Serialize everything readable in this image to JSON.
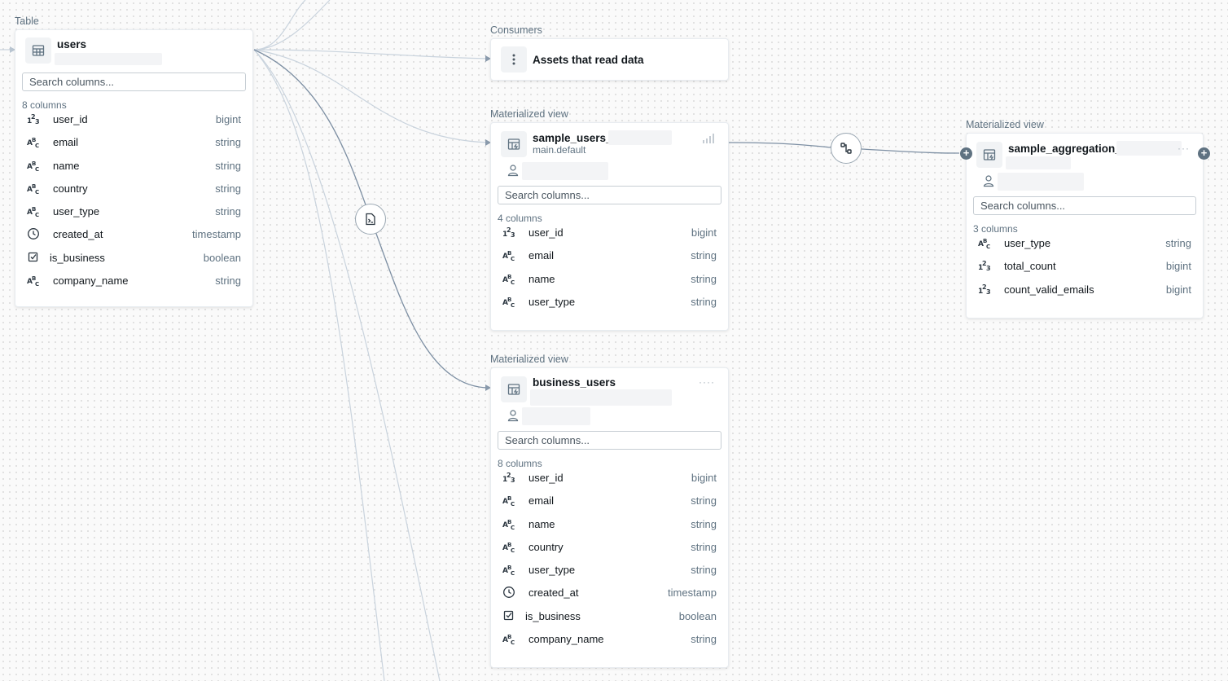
{
  "users_node": {
    "label": "Table",
    "title": "users",
    "search_placeholder": "Search columns...",
    "col_count": "8 columns",
    "columns": [
      {
        "name": "user_id",
        "type": "bigint",
        "icon": "number-icon"
      },
      {
        "name": "email",
        "type": "string",
        "icon": "string-icon"
      },
      {
        "name": "name",
        "type": "string",
        "icon": "string-icon"
      },
      {
        "name": "country",
        "type": "string",
        "icon": "string-icon"
      },
      {
        "name": "user_type",
        "type": "string",
        "icon": "string-icon"
      },
      {
        "name": "created_at",
        "type": "timestamp",
        "icon": "clock-icon"
      },
      {
        "name": "is_business",
        "type": "boolean",
        "icon": "checkbox-icon"
      },
      {
        "name": "company_name",
        "type": "string",
        "icon": "string-icon"
      }
    ]
  },
  "consumers_node": {
    "label": "Consumers",
    "title": "Assets that read data"
  },
  "sample_users_node": {
    "label": "Materialized view",
    "title": "sample_users_",
    "subtitle": "main.default",
    "search_placeholder": "Search columns...",
    "col_count": "4 columns",
    "columns": [
      {
        "name": "user_id",
        "type": "bigint",
        "icon": "number-icon"
      },
      {
        "name": "email",
        "type": "string",
        "icon": "string-icon"
      },
      {
        "name": "name",
        "type": "string",
        "icon": "string-icon"
      },
      {
        "name": "user_type",
        "type": "string",
        "icon": "string-icon"
      }
    ]
  },
  "business_users_node": {
    "label": "Materialized view",
    "title": "business_users",
    "search_placeholder": "Search columns...",
    "col_count": "8 columns",
    "columns": [
      {
        "name": "user_id",
        "type": "bigint",
        "icon": "number-icon"
      },
      {
        "name": "email",
        "type": "string",
        "icon": "string-icon"
      },
      {
        "name": "name",
        "type": "string",
        "icon": "string-icon"
      },
      {
        "name": "country",
        "type": "string",
        "icon": "string-icon"
      },
      {
        "name": "user_type",
        "type": "string",
        "icon": "string-icon"
      },
      {
        "name": "created_at",
        "type": "timestamp",
        "icon": "clock-icon"
      },
      {
        "name": "is_business",
        "type": "boolean",
        "icon": "checkbox-icon"
      },
      {
        "name": "company_name",
        "type": "string",
        "icon": "string-icon"
      }
    ]
  },
  "sample_aggregation_node": {
    "label": "Materialized view",
    "title": "sample_aggregation_",
    "search_placeholder": "Search columns...",
    "col_count": "3 columns",
    "columns": [
      {
        "name": "user_type",
        "type": "string",
        "icon": "string-icon"
      },
      {
        "name": "total_count",
        "type": "bigint",
        "icon": "number-icon"
      },
      {
        "name": "count_valid_emails",
        "type": "bigint",
        "icon": "number-icon"
      }
    ]
  },
  "colors": {
    "edge": "#8193a8",
    "edge_light": "#c5d0db",
    "accent": "#5f7281"
  }
}
